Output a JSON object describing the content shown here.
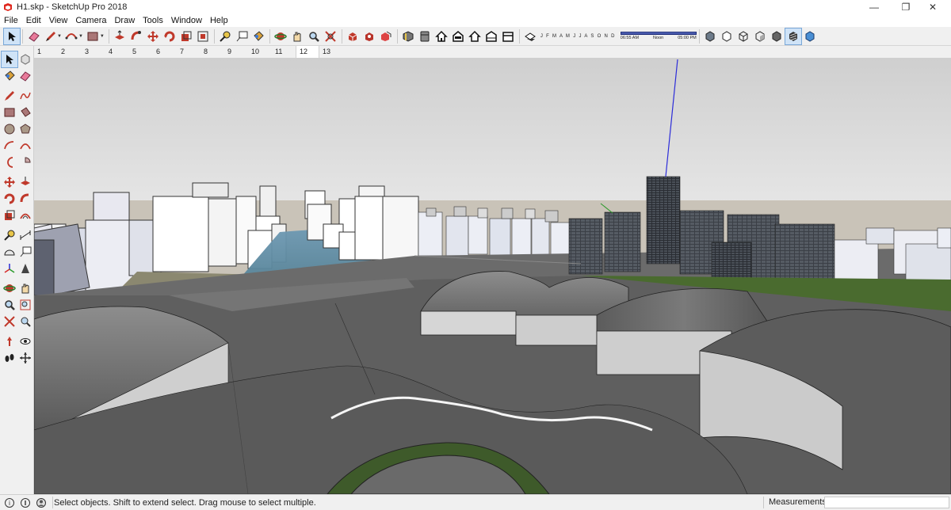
{
  "window": {
    "title": "H1.skp - SketchUp Pro 2018",
    "controls": {
      "minimize": "—",
      "maximize": "❐",
      "close": "✕"
    }
  },
  "menu": [
    "File",
    "Edit",
    "View",
    "Camera",
    "Draw",
    "Tools",
    "Window",
    "Help"
  ],
  "shadows": {
    "months": "J F M A M J J A S O N D",
    "time_start": "06:55 AM",
    "time_noon": "Noon",
    "time_end": "05:00 PM"
  },
  "scenes": {
    "tabs": [
      "1",
      "2",
      "3",
      "4",
      "5",
      "6",
      "7",
      "8",
      "9",
      "10",
      "11",
      "12",
      "13"
    ],
    "active_index": 11
  },
  "status": {
    "hint": "Select objects. Shift to extend select. Drag mouse to select multiple.",
    "measurements_label": "Measurements",
    "measurements_value": ""
  },
  "colors": {
    "sky": "#d8d8d8",
    "ground": "#5c5c5c",
    "axis_blue": "#2b2bd9",
    "axis_green": "#2a9a2a",
    "axis_red": "#d62a2a",
    "accent": "#7aa8d8"
  },
  "icons": {
    "toolbar": [
      "select-icon",
      "eraser-icon",
      "pencil-icon",
      "arc-icon",
      "rectangle-icon",
      "push-pull-icon",
      "move-icon",
      "rotate-icon",
      "scale-icon",
      "offset-icon",
      "tape-measure-icon",
      "text-icon",
      "paint-bucket-icon",
      "orbit-icon",
      "pan-icon",
      "zoom-icon",
      "zoom-extents-icon",
      "warehouse-icon",
      "extension-icon",
      "components-icon",
      "section-icon",
      "iso-view-icon",
      "top-view-icon",
      "front-view-icon",
      "right-view-icon",
      "back-view-icon",
      "left-view-icon",
      "shadow-toggle-icon",
      "xray-icon",
      "wireframe-icon",
      "hidden-line-icon",
      "shaded-icon",
      "textured-icon",
      "monochrome-icon"
    ],
    "status": [
      "geo-location-icon",
      "credit-icon",
      "user-icon"
    ]
  }
}
